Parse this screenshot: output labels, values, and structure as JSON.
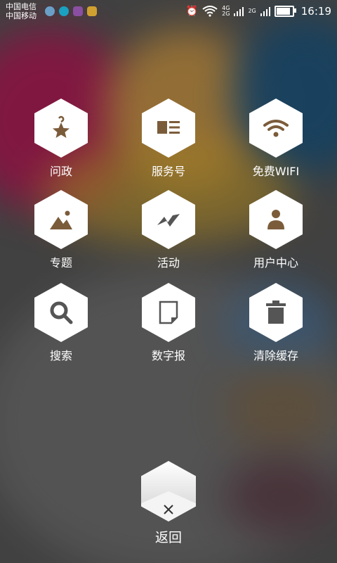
{
  "status": {
    "carrier1": "中国电信",
    "carrier2": "中国移动",
    "net_top": "4G",
    "net_bottom": "2G",
    "net2": "2G",
    "time": "16:19",
    "battery_level": 0.8
  },
  "menu": {
    "items": [
      {
        "label": "问政",
        "icon": "star-hanger-icon"
      },
      {
        "label": "服务号",
        "icon": "newspaper-icon"
      },
      {
        "label": "免费WIFI",
        "icon": "wifi-icon"
      },
      {
        "label": "专题",
        "icon": "picture-icon"
      },
      {
        "label": "活动",
        "icon": "activity-bolt-icon"
      },
      {
        "label": "用户中心",
        "icon": "user-icon"
      },
      {
        "label": "搜索",
        "icon": "search-icon"
      },
      {
        "label": "数字报",
        "icon": "page-icon"
      },
      {
        "label": "清除缓存",
        "icon": "trash-icon"
      }
    ]
  },
  "back": {
    "label": "返回",
    "icon": "close-icon"
  },
  "colors": {
    "icon_brown": "#7b5c3a",
    "icon_gray": "#555555"
  }
}
